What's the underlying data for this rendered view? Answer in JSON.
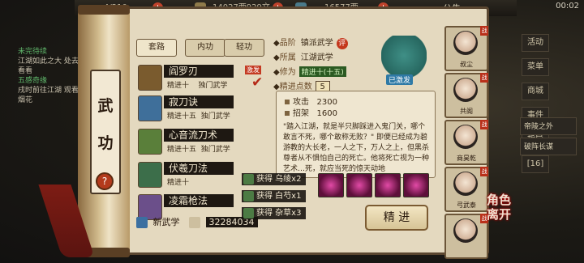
{
  "topbar": {
    "calendar": "…4/210",
    "money": "14027两929文",
    "gems": "16577两",
    "announcement": "公告",
    "clock": "00:02"
  },
  "quest": {
    "q1_title": "未完待续",
    "q1_desc": "江湖如此之大 处去看看",
    "q2_title": "五感奇缘",
    "q2_desc": "戌时前往江湖 观看烟花"
  },
  "right_menu": [
    "活动",
    "菜单",
    "商城",
    "事件",
    "指导",
    "[16]"
  ],
  "right_buttons": [
    "帝陵之外",
    "破阵长谋"
  ],
  "role_switch": [
    "角色",
    "离开"
  ],
  "panel": {
    "title_top": "武",
    "title_bottom": "功",
    "help": "?"
  },
  "tabs": [
    "套路",
    "内功",
    "轻功"
  ],
  "skills": [
    {
      "name": "阎罗刃",
      "sub": "精进十    独门武学",
      "badge": "激发",
      "checked": true,
      "color": "#7a5b2e"
    },
    {
      "name": "寂刀诀",
      "sub": "精进十五  独门武学",
      "badge": "",
      "checked": false,
      "color": "#3f6f9a"
    },
    {
      "name": "心音流刀术",
      "sub": "精进十五  独门武学",
      "badge": "",
      "checked": false,
      "color": "#5a7f3a"
    },
    {
      "name": "伏羲刀法",
      "sub": "精进十",
      "badge": "",
      "checked": false,
      "color": "#3c6e4a"
    },
    {
      "name": "凌霜枪法",
      "sub": "",
      "badge": "",
      "checked": false,
      "color": "#6b4f8a"
    }
  ],
  "footer": {
    "new_label": "新武学",
    "points": "32284034"
  },
  "detail": {
    "grade_key": "品阶",
    "grade_val": "镇派武学",
    "eval": "评",
    "faction_key": "所属",
    "faction_val": "江湖武学",
    "cultivation_key": "修为",
    "cultivation_val": "精进十(十五)",
    "points_key": "精进点数",
    "points_val": "5",
    "mastered": "已激发",
    "attack_key": "攻击",
    "attack_val": "2300",
    "parry_key": "招架",
    "parry_val": "1600",
    "desc": "\"踏入江湖，就是半只脚踩进入鬼门关，哪个敢言不死，哪个敢称无败？\" 即便已经成为碧游教的大长老，一人之下，万人之上，但黑杀尊者从不惧怕自己的死亡。他将死亡视为一种艺术…死，就应当死的惊天动地"
  },
  "drops": [
    "获得 乌绫x2",
    "获得 白芍x1",
    "获得 杂草x3"
  ],
  "advance": "精 进",
  "portraits": [
    {
      "name": "叔尘",
      "tag": "战"
    },
    {
      "name": "共阁",
      "tag": "战"
    },
    {
      "name": "商昊乾",
      "tag": "战"
    },
    {
      "name": "弓武泰",
      "tag": "战"
    },
    {
      "name": "",
      "tag": "战"
    }
  ],
  "colors": {
    "accent_red": "#c4381d",
    "parchment": "#e4d9bf",
    "ink": "#1e1812"
  }
}
